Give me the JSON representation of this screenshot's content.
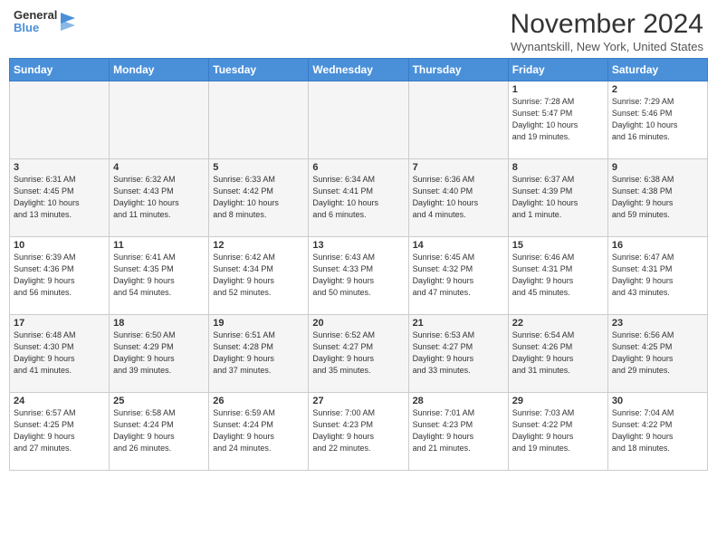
{
  "header": {
    "logo": {
      "general": "General",
      "blue": "Blue"
    },
    "title": "November 2024",
    "location": "Wynantskill, New York, United States"
  },
  "calendar": {
    "days_of_week": [
      "Sunday",
      "Monday",
      "Tuesday",
      "Wednesday",
      "Thursday",
      "Friday",
      "Saturday"
    ],
    "weeks": [
      [
        {
          "day": "",
          "empty": true
        },
        {
          "day": "",
          "empty": true
        },
        {
          "day": "",
          "empty": true
        },
        {
          "day": "",
          "empty": true
        },
        {
          "day": "",
          "empty": true
        },
        {
          "day": "1",
          "info": "Sunrise: 7:28 AM\nSunset: 5:47 PM\nDaylight: 10 hours\nand 19 minutes."
        },
        {
          "day": "2",
          "info": "Sunrise: 7:29 AM\nSunset: 5:46 PM\nDaylight: 10 hours\nand 16 minutes."
        }
      ],
      [
        {
          "day": "3",
          "info": "Sunrise: 6:31 AM\nSunset: 4:45 PM\nDaylight: 10 hours\nand 13 minutes."
        },
        {
          "day": "4",
          "info": "Sunrise: 6:32 AM\nSunset: 4:43 PM\nDaylight: 10 hours\nand 11 minutes."
        },
        {
          "day": "5",
          "info": "Sunrise: 6:33 AM\nSunset: 4:42 PM\nDaylight: 10 hours\nand 8 minutes."
        },
        {
          "day": "6",
          "info": "Sunrise: 6:34 AM\nSunset: 4:41 PM\nDaylight: 10 hours\nand 6 minutes."
        },
        {
          "day": "7",
          "info": "Sunrise: 6:36 AM\nSunset: 4:40 PM\nDaylight: 10 hours\nand 4 minutes."
        },
        {
          "day": "8",
          "info": "Sunrise: 6:37 AM\nSunset: 4:39 PM\nDaylight: 10 hours\nand 1 minute."
        },
        {
          "day": "9",
          "info": "Sunrise: 6:38 AM\nSunset: 4:38 PM\nDaylight: 9 hours\nand 59 minutes."
        }
      ],
      [
        {
          "day": "10",
          "info": "Sunrise: 6:39 AM\nSunset: 4:36 PM\nDaylight: 9 hours\nand 56 minutes."
        },
        {
          "day": "11",
          "info": "Sunrise: 6:41 AM\nSunset: 4:35 PM\nDaylight: 9 hours\nand 54 minutes."
        },
        {
          "day": "12",
          "info": "Sunrise: 6:42 AM\nSunset: 4:34 PM\nDaylight: 9 hours\nand 52 minutes."
        },
        {
          "day": "13",
          "info": "Sunrise: 6:43 AM\nSunset: 4:33 PM\nDaylight: 9 hours\nand 50 minutes."
        },
        {
          "day": "14",
          "info": "Sunrise: 6:45 AM\nSunset: 4:32 PM\nDaylight: 9 hours\nand 47 minutes."
        },
        {
          "day": "15",
          "info": "Sunrise: 6:46 AM\nSunset: 4:31 PM\nDaylight: 9 hours\nand 45 minutes."
        },
        {
          "day": "16",
          "info": "Sunrise: 6:47 AM\nSunset: 4:31 PM\nDaylight: 9 hours\nand 43 minutes."
        }
      ],
      [
        {
          "day": "17",
          "info": "Sunrise: 6:48 AM\nSunset: 4:30 PM\nDaylight: 9 hours\nand 41 minutes."
        },
        {
          "day": "18",
          "info": "Sunrise: 6:50 AM\nSunset: 4:29 PM\nDaylight: 9 hours\nand 39 minutes."
        },
        {
          "day": "19",
          "info": "Sunrise: 6:51 AM\nSunset: 4:28 PM\nDaylight: 9 hours\nand 37 minutes."
        },
        {
          "day": "20",
          "info": "Sunrise: 6:52 AM\nSunset: 4:27 PM\nDaylight: 9 hours\nand 35 minutes."
        },
        {
          "day": "21",
          "info": "Sunrise: 6:53 AM\nSunset: 4:27 PM\nDaylight: 9 hours\nand 33 minutes."
        },
        {
          "day": "22",
          "info": "Sunrise: 6:54 AM\nSunset: 4:26 PM\nDaylight: 9 hours\nand 31 minutes."
        },
        {
          "day": "23",
          "info": "Sunrise: 6:56 AM\nSunset: 4:25 PM\nDaylight: 9 hours\nand 29 minutes."
        }
      ],
      [
        {
          "day": "24",
          "info": "Sunrise: 6:57 AM\nSunset: 4:25 PM\nDaylight: 9 hours\nand 27 minutes."
        },
        {
          "day": "25",
          "info": "Sunrise: 6:58 AM\nSunset: 4:24 PM\nDaylight: 9 hours\nand 26 minutes."
        },
        {
          "day": "26",
          "info": "Sunrise: 6:59 AM\nSunset: 4:24 PM\nDaylight: 9 hours\nand 24 minutes."
        },
        {
          "day": "27",
          "info": "Sunrise: 7:00 AM\nSunset: 4:23 PM\nDaylight: 9 hours\nand 22 minutes."
        },
        {
          "day": "28",
          "info": "Sunrise: 7:01 AM\nSunset: 4:23 PM\nDaylight: 9 hours\nand 21 minutes."
        },
        {
          "day": "29",
          "info": "Sunrise: 7:03 AM\nSunset: 4:22 PM\nDaylight: 9 hours\nand 19 minutes."
        },
        {
          "day": "30",
          "info": "Sunrise: 7:04 AM\nSunset: 4:22 PM\nDaylight: 9 hours\nand 18 minutes."
        }
      ]
    ]
  }
}
